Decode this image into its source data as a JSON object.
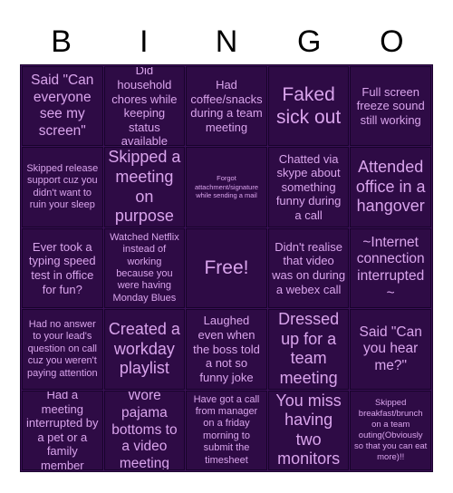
{
  "header": {
    "letters": [
      "B",
      "I",
      "N",
      "G",
      "O"
    ]
  },
  "colors": {
    "page_background": "#ffffff",
    "cell_background": "#2e0b45",
    "grid_line": "#3b1057",
    "cell_text": "#d9a4ec",
    "header_text": "#000000"
  },
  "board": {
    "rows": 5,
    "columns": 5,
    "cells": [
      {
        "text": "Said \"Can everyone see my screen\"",
        "size": "lg",
        "free": false
      },
      {
        "text": "Did household chores while keeping status available",
        "size": "md",
        "free": false
      },
      {
        "text": "Had coffee/snacks during a team meeting",
        "size": "md",
        "free": false
      },
      {
        "text": "Faked sick out",
        "size": "xxl",
        "free": false
      },
      {
        "text": "Full screen freeze sound still working",
        "size": "md",
        "free": false
      },
      {
        "text": "Skipped release support cuz you didn't want to ruin your sleep",
        "size": "sm",
        "free": false
      },
      {
        "text": "Skipped a meeting on purpose",
        "size": "xl",
        "free": false
      },
      {
        "text": "Forgot attachment/signature while sending a mail",
        "size": "xxs",
        "free": false
      },
      {
        "text": "Chatted via skype about something funny during a call",
        "size": "md",
        "free": false
      },
      {
        "text": "Attended office in a hangover",
        "size": "xl",
        "free": false
      },
      {
        "text": "Ever took a typing speed test in office for fun?",
        "size": "md",
        "free": false
      },
      {
        "text": "Watched Netflix instead of working because you were having Monday Blues",
        "size": "sm",
        "free": false
      },
      {
        "text": "Free!",
        "size": "xxl",
        "free": true
      },
      {
        "text": "Didn't realise that video was on during a webex call",
        "size": "md",
        "free": false
      },
      {
        "text": "~Internet connection interrupted~",
        "size": "lg",
        "free": false
      },
      {
        "text": "Had no answer to your lead's question on call cuz you weren't paying attention",
        "size": "sm",
        "free": false
      },
      {
        "text": "Created a workday playlist",
        "size": "xl",
        "free": false
      },
      {
        "text": "Laughed even when the boss told a not so funny joke",
        "size": "md",
        "free": false
      },
      {
        "text": "Dressed up for a team meeting",
        "size": "xl",
        "free": false
      },
      {
        "text": "Said \"Can you hear me?\"",
        "size": "lg",
        "free": false
      },
      {
        "text": "Had a meeting interrupted by a pet or a family member",
        "size": "md",
        "free": false
      },
      {
        "text": "Wore pajama bottoms to a video meeting",
        "size": "lg",
        "free": false
      },
      {
        "text": "Have got a call from manager on a friday morning to submit the timesheet",
        "size": "sm",
        "free": false
      },
      {
        "text": "You miss having two monitors",
        "size": "xl",
        "free": false
      },
      {
        "text": "Skipped breakfast/brunch on a team outing(Obviously so that you can eat more)!!",
        "size": "xs",
        "free": false
      }
    ]
  }
}
